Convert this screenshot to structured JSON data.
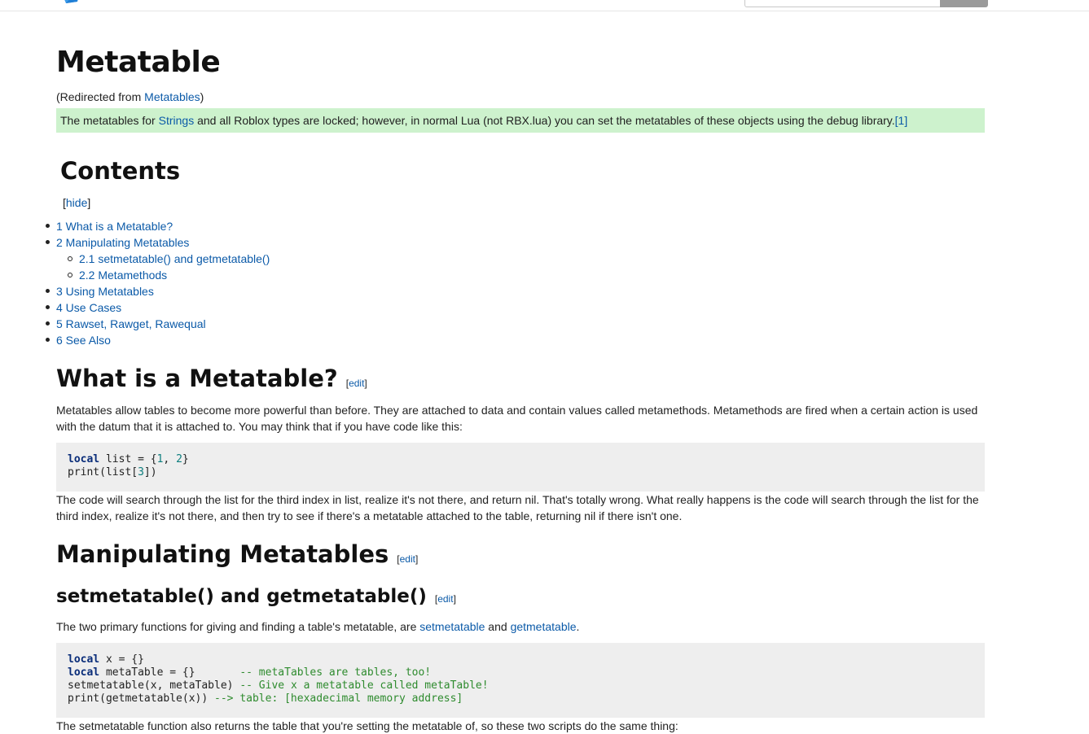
{
  "header": {
    "search_placeholder": ""
  },
  "page": {
    "title": "Metatable",
    "redirect_prefix": "(Redirected from ",
    "redirect_link": "Metatables",
    "redirect_suffix": ")"
  },
  "notice": {
    "text_1": "The metatables for ",
    "link_strings": "Strings",
    "text_2": " and all Roblox types are locked; however, in normal Lua (not RBX.lua) you can set the metatables of these objects using the debug library.",
    "ref": "[1]",
    "bg_color": "#cdf2cd"
  },
  "toc": {
    "title": "Contents",
    "hide_open": "[",
    "hide_label": "hide",
    "hide_close": "]",
    "items": [
      {
        "label": "1 What is a Metatable?"
      },
      {
        "label": "2 Manipulating Metatables"
      },
      {
        "label": "2.1 setmetatable() and getmetatable()"
      },
      {
        "label": "2.2 Metamethods"
      },
      {
        "label": "3 Using Metatables"
      },
      {
        "label": "4 Use Cases"
      },
      {
        "label": "5 Rawset, Rawget, Rawequal"
      },
      {
        "label": "6 See Also"
      }
    ]
  },
  "sections": {
    "what": {
      "heading": "What is a Metatable?",
      "edit": "edit",
      "para1": "Metatables allow tables to become more powerful than before. They are attached to data and contain values called metamethods. Metamethods are fired when a certain action is used with the datum that it is attached to. You may think that if you have code like this:",
      "code_l1_kw": "local",
      "code_l1_a": " list = {",
      "code_l1_n1": "1",
      "code_l1_b": ", ",
      "code_l1_n2": "2",
      "code_l1_c": "}",
      "code_l2_a": "print(list[",
      "code_l2_n": "3",
      "code_l2_b": "])",
      "para2": "The code will search through the list for the third index in list, realize it's not there, and return nil. That's totally wrong. What really happens is the code will search through the list for the third index, realize it's not there, and then try to see if there's a metatable attached to the table, returning nil if there isn't one."
    },
    "manip": {
      "heading": "Manipulating Metatables",
      "edit": "edit"
    },
    "setget": {
      "heading": "setmetatable() and getmetatable()",
      "edit": "edit",
      "para1_a": "The two primary functions for giving and finding a table's metatable, are ",
      "link_set": "setmetatable",
      "para1_b": " and ",
      "link_get": "getmetatable",
      "para1_c": ".",
      "c1_kw": "local",
      "c1_rest": " x = {}",
      "c2_kw": "local",
      "c2_rest": " metaTable = {}       ",
      "c2_cm": "-- metaTables are tables, too!",
      "c3_rest": "setmetatable(x, metaTable) ",
      "c3_cm": "-- Give x a metatable called metaTable!",
      "c4_rest": "print(getmetatable(x)) ",
      "c4_cm": "--> table: [hexadecimal memory address]",
      "para2": "The setmetatable function also returns the table that you're setting the metatable of, so these two scripts do the same thing:"
    }
  }
}
